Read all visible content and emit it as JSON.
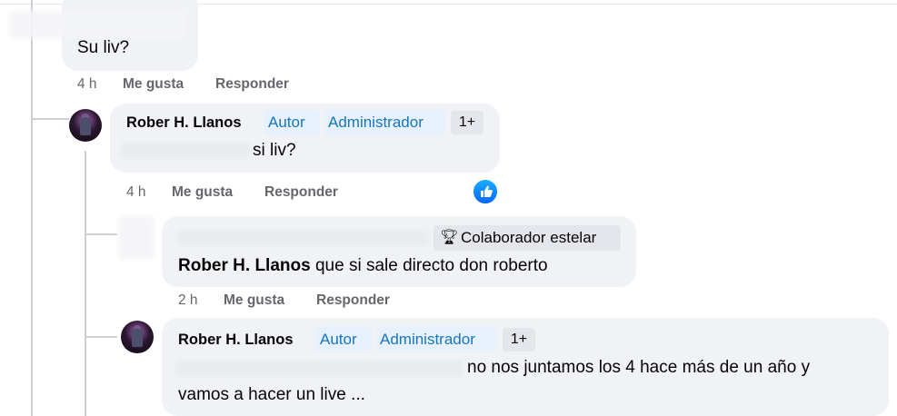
{
  "comments": [
    {
      "text": "Su liv?",
      "time": "4 h",
      "like_label": "Me gusta",
      "reply_label": "Responder"
    },
    {
      "author": "Rober H. Llanos",
      "badges": [
        "Autor",
        "Administrador"
      ],
      "extra_badge": "1+",
      "text": "si liv?",
      "time": "4 h",
      "like_label": "Me gusta",
      "reply_label": "Responder",
      "reaction": "like-icon"
    },
    {
      "badge_star": "Colaborador estelar",
      "mention": "Rober H. Llanos",
      "text": " que si sale directo don roberto",
      "time": "2 h",
      "like_label": "Me gusta",
      "reply_label": "Responder"
    },
    {
      "author": "Rober H. Llanos",
      "badges": [
        "Autor",
        "Administrador"
      ],
      "extra_badge": "1+",
      "text_line1": "no nos juntamos los 4 hace más de un año y",
      "text_line2": "vamos a hacer un live ..."
    }
  ],
  "colors": {
    "bubble": "#f0f2f5",
    "badge_text": "#1877b8",
    "meta_text": "#65676b",
    "like_blue": "#0866ff"
  }
}
